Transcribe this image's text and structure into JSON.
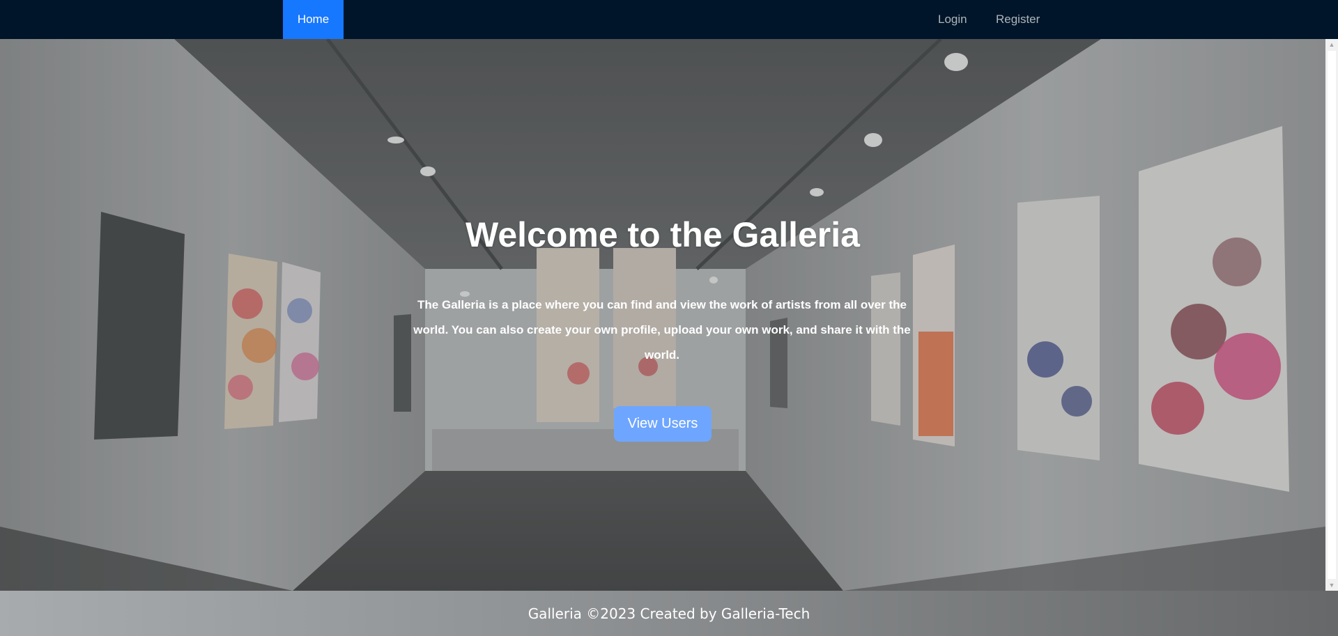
{
  "navbar": {
    "home_label": "Home",
    "login_label": "Login",
    "register_label": "Register",
    "background_color": "#001529",
    "active_color": "#1677ff"
  },
  "hero": {
    "title": "Welcome to the Galleria",
    "description": "The Galleria is a place where you can find and view the work of artists from all over the world. You can also create your own profile, upload your own work, and share it with the world.",
    "button_label": "View Users",
    "button_color": "#6ea6ff",
    "background_image": "art-gallery-hallway"
  },
  "footer": {
    "text": "Galleria ©2023 Created by Galleria-Tech"
  },
  "scrollbar": {
    "up_icon": "triangle-up-icon",
    "down_icon": "triangle-down-icon"
  }
}
